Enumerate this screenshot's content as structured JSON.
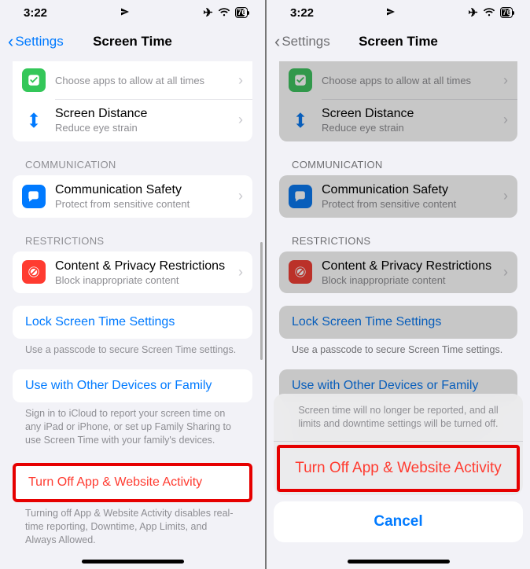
{
  "status": {
    "time": "3:22",
    "battery": "76"
  },
  "nav": {
    "back": "Settings",
    "title": "Screen Time"
  },
  "rows": {
    "always": {
      "sub": "Choose apps to allow at all times"
    },
    "distance": {
      "title": "Screen Distance",
      "sub": "Reduce eye strain"
    },
    "commHeader": "COMMUNICATION",
    "commSafety": {
      "title": "Communication Safety",
      "sub": "Protect from sensitive content"
    },
    "restrHeader": "RESTRICTIONS",
    "contentPriv": {
      "title": "Content & Privacy Restrictions",
      "sub": "Block inappropriate content"
    }
  },
  "links": {
    "lock": "Lock Screen Time Settings",
    "lockFooter": "Use a passcode to secure Screen Time settings.",
    "family": "Use with Other Devices or Family",
    "familyFooter": "Sign in to iCloud to report your screen time on any iPad or iPhone, or set up Family Sharing to use Screen Time with your family's devices.",
    "turnOff": "Turn Off App & Website Activity",
    "turnOffFooter": "Turning off App & Website Activity disables real-time reporting, Downtime, App Limits, and Always Allowed."
  },
  "sheet": {
    "msg": "Screen time will no longer be reported, and all limits and downtime settings will be turned off.",
    "action": "Turn Off App & Website Activity",
    "cancel": "Cancel"
  }
}
